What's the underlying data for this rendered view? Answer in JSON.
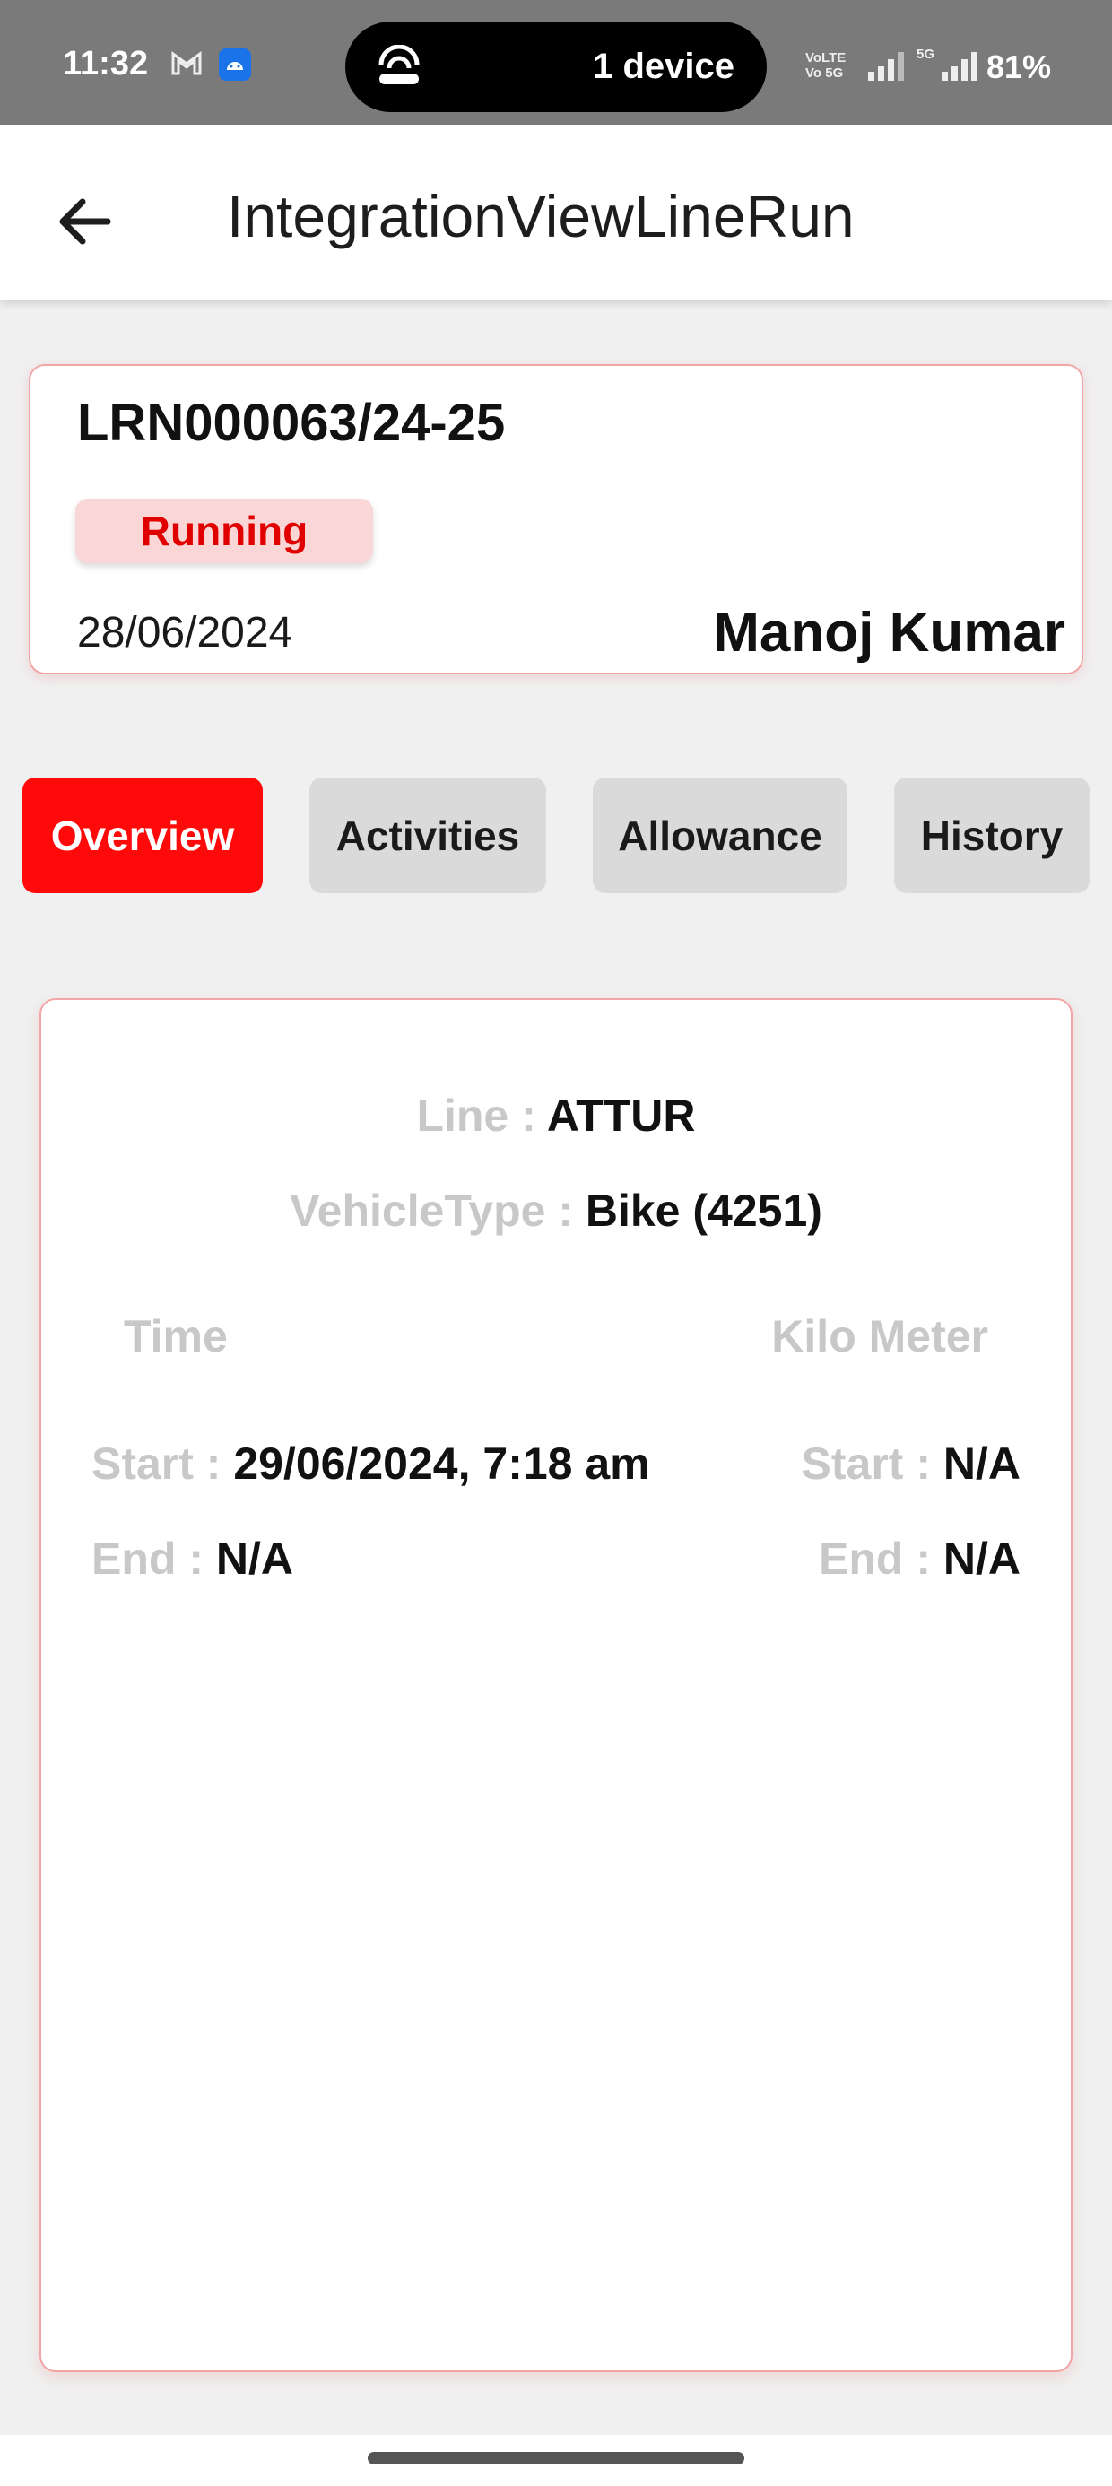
{
  "status_bar": {
    "time": "11:32",
    "device_text": "1 device",
    "network_label": "VoLTE\nVo 5G",
    "network_5g": "5G",
    "battery": "81%",
    "icons": [
      "gmail-icon",
      "android-app-icon",
      "hotspot-icon",
      "signal-icon",
      "battery-icon"
    ]
  },
  "app_bar": {
    "title": "IntegrationViewLineRun",
    "back_icon": "arrow-left-icon"
  },
  "summary": {
    "code": "LRN000063/24-25",
    "status": "Running",
    "date": "28/06/2024",
    "driver": "Manoj Kumar"
  },
  "tabs": [
    {
      "label": "Overview",
      "active": true
    },
    {
      "label": "Activities",
      "active": false
    },
    {
      "label": "Allowance",
      "active": false
    },
    {
      "label": "History",
      "active": false
    }
  ],
  "details": {
    "line_label": "Line : ",
    "line_value": "ATTUR",
    "vehicle_label": "VehicleType : ",
    "vehicle_value": "Bike (4251)",
    "time_header": "Time",
    "km_header": "Kilo Meter",
    "time_start_label": "Start : ",
    "time_start_value": "29/06/2024, 7:18 am",
    "time_end_label": "End : ",
    "time_end_value": "N/A",
    "km_start_label": "Start : ",
    "km_start_value": "N/A",
    "km_end_label": "End : ",
    "km_end_value": "N/A"
  },
  "colors": {
    "accent": "#ff0a0a",
    "status_bg": "#fbd6d6",
    "card_border": "#f2a5a5",
    "label_gray": "#c8c8c8"
  }
}
